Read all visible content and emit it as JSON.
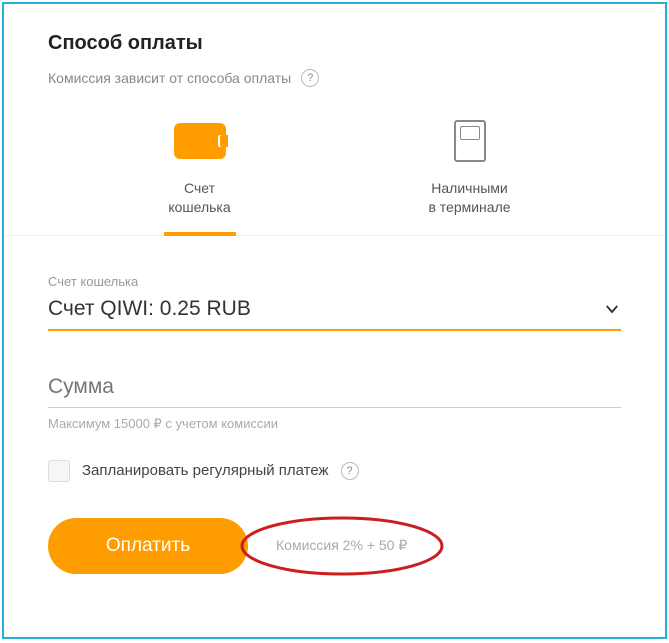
{
  "header": {
    "title": "Способ оплаты",
    "subtitle": "Комиссия зависит от способа оплаты",
    "help": "?"
  },
  "methods": {
    "wallet": {
      "line1": "Счет",
      "line2": "кошелька"
    },
    "terminal": {
      "line1": "Наличными",
      "line2": "в терминале"
    }
  },
  "wallet_select": {
    "label": "Счет кошелька",
    "value": "Счет QIWI: 0.25 RUB"
  },
  "amount": {
    "placeholder": "Сумма",
    "hint": "Максимум 15000 ₽ с учетом комиссии"
  },
  "schedule": {
    "label": "Запланировать регулярный платеж",
    "help": "?"
  },
  "action": {
    "pay": "Оплатить",
    "commission": "Комиссия 2% + 50 ₽"
  }
}
